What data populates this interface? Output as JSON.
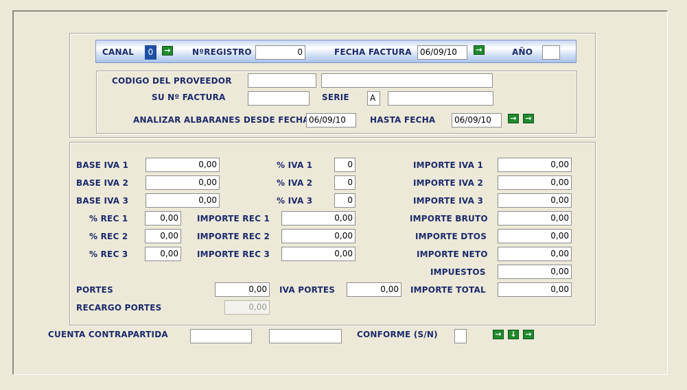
{
  "header": {
    "canal_label": "CANAL",
    "canal_value": "0",
    "registro_label": "NºREGISTRO",
    "registro_value": "0",
    "fecha_factura_label": "FECHA FACTURA",
    "fecha_factura_value": "06/09/10",
    "anio_label": "AÑO",
    "anio_value": ""
  },
  "proveedor": {
    "codigo_label": "CODIGO DEL PROVEEDOR",
    "codigo_value": "",
    "nombre_value": "",
    "factura_label": "SU Nº FACTURA",
    "factura_value": "",
    "serie_label": "SERIE",
    "serie_value": "A",
    "serie_desc_value": "",
    "analizar_label": "ANALIZAR ALBARANES DESDE FECHA",
    "desde_value": "06/09/10",
    "hasta_label": "HASTA FECHA",
    "hasta_value": "06/09/10"
  },
  "importes": {
    "base_iva_1_label": "BASE IVA 1",
    "base_iva_1": "0,00",
    "base_iva_2_label": "BASE IVA 2",
    "base_iva_2": "0,00",
    "base_iva_3_label": "BASE IVA 3",
    "base_iva_3": "0,00",
    "pct_iva_1_label": "% IVA 1",
    "pct_iva_1": "0",
    "pct_iva_2_label": "% IVA 2",
    "pct_iva_2": "0",
    "pct_iva_3_label": "% IVA 3",
    "pct_iva_3": "0",
    "importe_iva_1_label": "IMPORTE IVA 1",
    "importe_iva_1": "0,00",
    "importe_iva_2_label": "IMPORTE IVA 2",
    "importe_iva_2": "0,00",
    "importe_iva_3_label": "IMPORTE IVA 3",
    "importe_iva_3": "0,00",
    "pct_rec_1_label": "% REC 1",
    "pct_rec_1": "0,00",
    "pct_rec_2_label": "% REC 2",
    "pct_rec_2": "0,00",
    "pct_rec_3_label": "% REC 3",
    "pct_rec_3": "0,00",
    "importe_rec_1_label": "IMPORTE REC 1",
    "importe_rec_1": "0,00",
    "importe_rec_2_label": "IMPORTE REC 2",
    "importe_rec_2": "0,00",
    "importe_rec_3_label": "IMPORTE REC 3",
    "importe_rec_3": "0,00",
    "importe_bruto_label": "IMPORTE BRUTO",
    "importe_bruto": "0,00",
    "importe_dtos_label": "IMPORTE DTOS",
    "importe_dtos": "0,00",
    "importe_neto_label": "IMPORTE NETO",
    "importe_neto": "0,00",
    "impuestos_label": "IMPUESTOS",
    "impuestos": "0,00",
    "portes_label": "PORTES",
    "portes": "0,00",
    "iva_portes_label": "IVA PORTES",
    "iva_portes": "0,00",
    "importe_total_label": "IMPORTE TOTAL",
    "importe_total": "0,00",
    "recargo_portes_label": "RECARGO PORTES",
    "recargo_portes": "0,00"
  },
  "footer": {
    "cuenta_label": "CUENTA CONTRAPARTIDA",
    "cuenta_value": "",
    "cuenta_desc_value": "",
    "conforme_label": "CONFORME (S/N)",
    "conforme_value": ""
  },
  "icons": {
    "arrow_right": "→",
    "arrow_down": "↓",
    "accent_green": "#1f8a2c",
    "label_color": "#1c2a6b"
  }
}
